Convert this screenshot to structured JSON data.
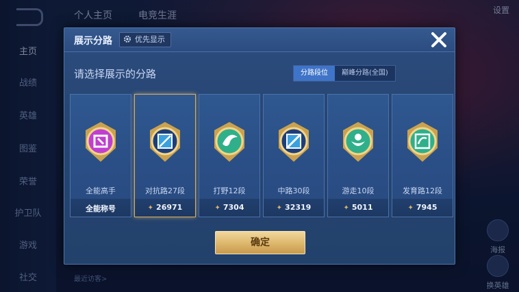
{
  "background": {
    "tabs": [
      "个人主页",
      "电竞生涯"
    ],
    "settings": "设置",
    "nav": [
      "主页",
      "战绩",
      "英雄",
      "图鉴",
      "荣誉",
      "护卫队",
      "游戏",
      "社交"
    ],
    "right_buttons": [
      "海报",
      "换英雄"
    ],
    "visitor": "最近访客>"
  },
  "modal": {
    "title": "展示分路",
    "priority_label": "优先显示",
    "prompt": "请选择展示的分路",
    "segments": [
      "分路段位",
      "巅峰分路(全国)"
    ],
    "active_segment": 0,
    "confirm_label": "确定"
  },
  "cards": [
    {
      "name": "全能高手",
      "value": "全能称号",
      "icon": "all-round-master-badge-icon",
      "color": "#c03fd0",
      "selected": false
    },
    {
      "name": "对抗路27段",
      "value": "26971",
      "icon": "clash-lane-badge-icon",
      "color": "#3aa0e0",
      "selected": true
    },
    {
      "name": "打野12段",
      "value": "7304",
      "icon": "jungle-badge-icon",
      "color": "#2fb08a",
      "selected": false
    },
    {
      "name": "中路30段",
      "value": "32319",
      "icon": "mid-lane-badge-icon",
      "color": "#3aa0e0",
      "selected": false
    },
    {
      "name": "游走10段",
      "value": "5011",
      "icon": "roam-badge-icon",
      "color": "#2fb08a",
      "selected": false
    },
    {
      "name": "发育路12段",
      "value": "7945",
      "icon": "farm-lane-badge-icon",
      "color": "#2fb08a",
      "selected": false
    }
  ]
}
